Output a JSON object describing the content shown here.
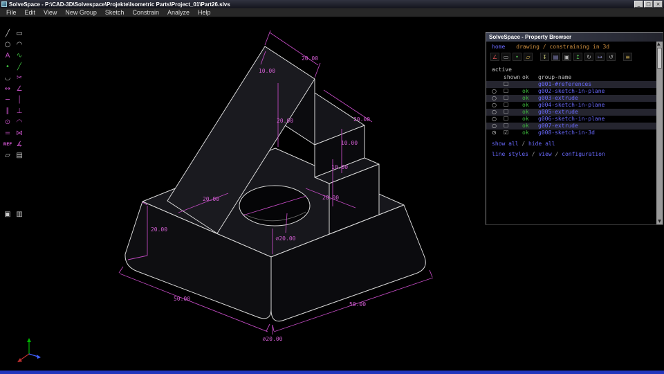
{
  "window": {
    "title": "SolveSpace - P:\\CAD-3D\\Solvespace\\Projekte\\Isometric Parts\\Project_01\\Part26.slvs",
    "minimize": "_",
    "maximize": "□",
    "close": "×"
  },
  "menus": [
    "File",
    "Edit",
    "View",
    "New Group",
    "Sketch",
    "Constrain",
    "Analyze",
    "Help"
  ],
  "toolbar": {
    "icons": [
      {
        "name": "line-tool",
        "glyph": "╱"
      },
      {
        "name": "rectangle-tool",
        "glyph": "▭"
      },
      {
        "name": "circle-tool",
        "glyph": "○"
      },
      {
        "name": "arc-tool",
        "glyph": "◠"
      },
      {
        "name": "text-tool",
        "glyph": "A"
      },
      {
        "name": "spline-tool",
        "glyph": "∿"
      },
      {
        "name": "point-tool",
        "glyph": "•"
      },
      {
        "name": "construction-tool",
        "glyph": "╱"
      },
      {
        "name": "tangent-arc-tool",
        "glyph": "◡"
      },
      {
        "name": "split-curves-tool",
        "glyph": "✂"
      },
      {
        "name": "distance-constraint-icon",
        "glyph": "↔"
      },
      {
        "name": "angle-constraint-icon",
        "glyph": "∠"
      },
      {
        "name": "horizontal-constraint-icon",
        "glyph": "─"
      },
      {
        "name": "vertical-constraint-icon",
        "glyph": "│"
      },
      {
        "name": "parallel-constraint-icon",
        "glyph": "∥"
      },
      {
        "name": "perpendicular-constraint-icon",
        "glyph": "⊥"
      },
      {
        "name": "point-on-line-constraint-icon",
        "glyph": "⊙"
      },
      {
        "name": "tangent-constraint-icon",
        "glyph": "◠"
      },
      {
        "name": "equal-constraint-icon",
        "glyph": "="
      },
      {
        "name": "symmetric-constraint-icon",
        "glyph": "⋈"
      },
      {
        "name": "reference-dimension-icon",
        "glyph": "REF"
      },
      {
        "name": "reference-angle-icon",
        "glyph": "∡"
      },
      {
        "name": "sketch-in-plane-icon",
        "glyph": "▱"
      },
      {
        "name": "extrude-icon",
        "glyph": "▤"
      },
      {
        "name": "copy-icon",
        "glyph": "▣"
      },
      {
        "name": "paste-icon",
        "glyph": "▥"
      }
    ]
  },
  "canvas": {
    "dimensions": {
      "d_top_ridge": "20.00",
      "d_apex": "10.00",
      "d_wall_height": "20.00",
      "d_ledge": "20.00",
      "d_step1": "10.00",
      "d_step2": "10.00",
      "d_top_left": "20.00",
      "d_top_right": "20.00",
      "d_hole_top": "⌀20.00",
      "d_left_height": "20.00",
      "d_base_left": "50.00",
      "d_base_right": "50.00",
      "d_hole_bottom": "⌀20.00"
    }
  },
  "property_browser": {
    "title": "SolveSpace - Property Browser",
    "nav": {
      "home": "home",
      "section": "drawing / constraining in 3d"
    },
    "icons": [
      {
        "name": "angle-icon",
        "glyph": "∠"
      },
      {
        "name": "distance-icon",
        "glyph": "▭"
      },
      {
        "name": "point-icon",
        "glyph": "•"
      },
      {
        "name": "workplane-icon",
        "glyph": "▱"
      },
      {
        "name": "import-icon",
        "glyph": "↧"
      },
      {
        "name": "group-icon",
        "glyph": "▤"
      },
      {
        "name": "sketch-icon",
        "glyph": "▣"
      },
      {
        "name": "extrude-icon",
        "glyph": "↥"
      },
      {
        "name": "lathe-icon",
        "glyph": "↻"
      },
      {
        "name": "translate-icon",
        "glyph": "↦"
      },
      {
        "name": "rotate-icon",
        "glyph": "↺"
      },
      {
        "name": "config-icon",
        "glyph": "≡"
      }
    ],
    "active_label": "active",
    "columns": {
      "shown": "shown",
      "ok": "ok",
      "name": "group-name"
    },
    "groups": [
      {
        "radio": "",
        "shown": "☐",
        "ok": "",
        "name": "g001-#references"
      },
      {
        "radio": "○",
        "shown": "☐",
        "ok": "ok",
        "name": "g002-sketch-in-plane"
      },
      {
        "radio": "○",
        "shown": "☐",
        "ok": "ok",
        "name": "g003-extrude"
      },
      {
        "radio": "○",
        "shown": "☐",
        "ok": "ok",
        "name": "g004-sketch-in-plane"
      },
      {
        "radio": "○",
        "shown": "☐",
        "ok": "ok",
        "name": "g005-extrude"
      },
      {
        "radio": "○",
        "shown": "☐",
        "ok": "ok",
        "name": "g006-sketch-in-plane"
      },
      {
        "radio": "○",
        "shown": "☐",
        "ok": "ok",
        "name": "g007-extrude"
      },
      {
        "radio": "⊙",
        "shown": "☑",
        "ok": "ok",
        "name": "g008-sketch-in-3d"
      }
    ],
    "links": {
      "show_all": "show all",
      "sep": " / ",
      "hide_all": "hide all",
      "line_styles": "line styles",
      "view": "view",
      "configuration": "configuration"
    },
    "scrollbar": {
      "up": "▲",
      "down": "▼"
    }
  }
}
